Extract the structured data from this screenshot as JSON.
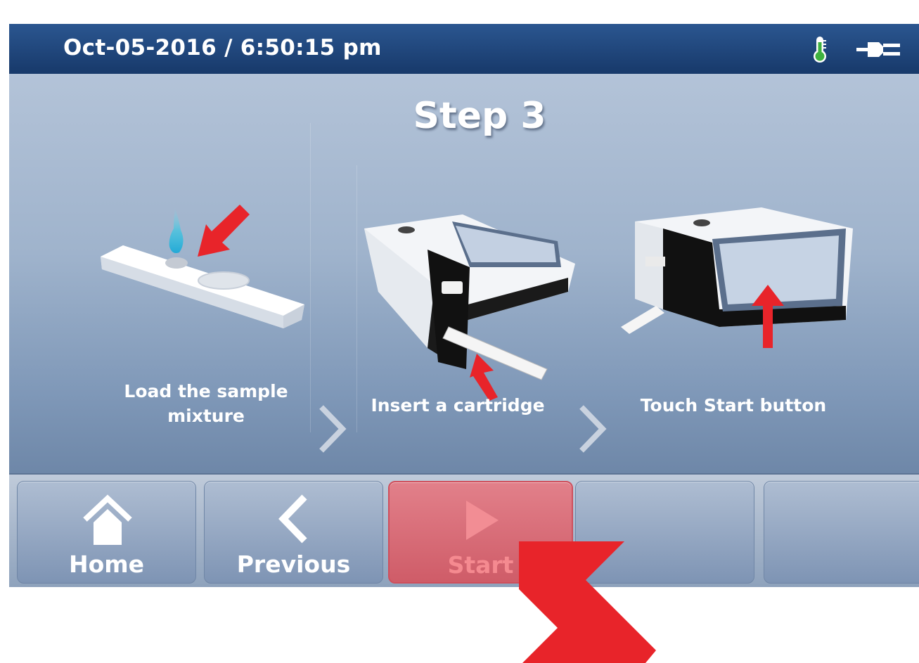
{
  "header": {
    "datetime": "Oct-05-2016 / 6:50:15 pm",
    "icons": [
      "thermometer-icon",
      "power-plug-icon"
    ]
  },
  "main": {
    "step_title": "Step 3",
    "steps": [
      {
        "label": "Load the sample\nmixture",
        "illustration": "sample-strip-with-drop"
      },
      {
        "label": "Insert a cartridge",
        "illustration": "device-with-cartridge"
      },
      {
        "label": "Touch Start button",
        "illustration": "device-touchscreen"
      }
    ]
  },
  "toolbar": {
    "home_label": "Home",
    "previous_label": "Previous",
    "start_label": "Start"
  },
  "colors": {
    "header": "#1f4679",
    "highlight_arrow": "#e8242a",
    "start_button": "#d96a75"
  }
}
